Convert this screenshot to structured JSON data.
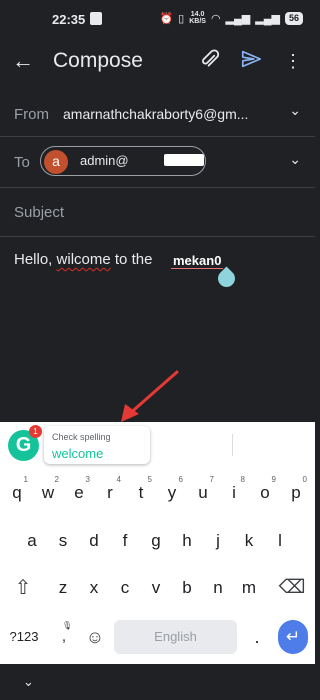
{
  "status": {
    "time": "22:35",
    "speed_value": "14.0",
    "speed_unit": "KB/S",
    "battery": "56"
  },
  "appbar": {
    "back_glyph": "←",
    "title": "Compose",
    "attach_glyph": "⊂⊃",
    "more_glyph": "⋮"
  },
  "from": {
    "label": "From",
    "value": "amarnathchakraborty6@gm...",
    "chevron": "⌄"
  },
  "to": {
    "label": "To",
    "avatar_letter": "a",
    "recipient": "admin@",
    "chevron": "⌄"
  },
  "subject": {
    "placeholder": "Subject"
  },
  "body": {
    "part1": "Hello, ",
    "error_word": "wilcome",
    "part2": " to the ",
    "highlight_word": "mekan0"
  },
  "grammarly": {
    "badge": "1",
    "logo_letter": "G",
    "label": "Check spelling",
    "suggestion": "welcome"
  },
  "keyboard": {
    "row1": [
      "q",
      "w",
      "e",
      "r",
      "t",
      "y",
      "u",
      "i",
      "o",
      "p"
    ],
    "row1_hints": [
      "1",
      "2",
      "3",
      "4",
      "5",
      "6",
      "7",
      "8",
      "9",
      "0"
    ],
    "row2": [
      "a",
      "s",
      "d",
      "f",
      "g",
      "h",
      "j",
      "k",
      "l"
    ],
    "row3": [
      "z",
      "x",
      "c",
      "v",
      "b",
      "n",
      "m"
    ],
    "shift_glyph": "⇧",
    "backspace_glyph": "⌫",
    "symbols": "?123",
    "comma": ",",
    "mic_glyph": "🎙",
    "emoji_glyph": "☺",
    "space_label": "English",
    "period": ".",
    "enter_glyph": "↵"
  },
  "nav": {
    "chevron": "⌄"
  },
  "colors": {
    "background": "#202124",
    "accent": "#8ab4f8",
    "grammarly": "#15c39a",
    "avatar": "#c1502e",
    "enter": "#4e7de9",
    "arrow": "#e53935"
  }
}
